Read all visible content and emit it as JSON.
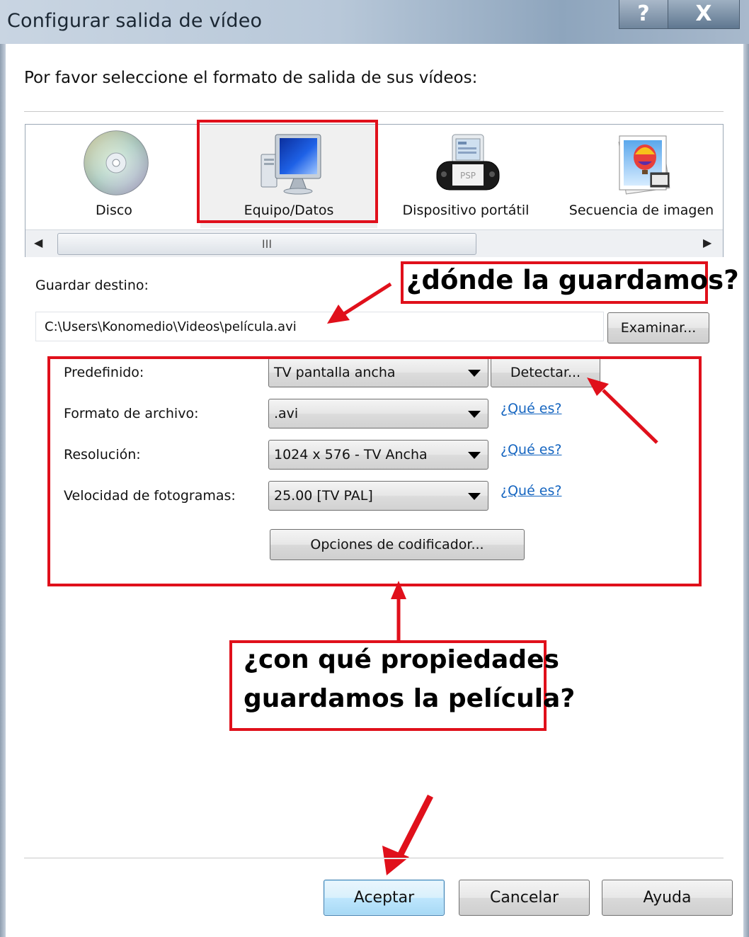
{
  "window": {
    "title": "Configurar salida de vídeo",
    "help_button": "?",
    "close_button": "X"
  },
  "prompt": "Por favor seleccione el formato de salida de sus vídeos:",
  "formats": [
    {
      "label": "Disco",
      "icon": "disc-icon"
    },
    {
      "label": "Equipo/Datos",
      "icon": "computer-icon"
    },
    {
      "label": "Dispositivo portátil",
      "icon": "psp-device-icon"
    },
    {
      "label": "Secuencia de imagen",
      "icon": "image-sequence-icon"
    }
  ],
  "psp_text": "PSP",
  "scrollbar": {
    "thumb_grip": "III",
    "left_arrow": "◀",
    "right_arrow": "▶"
  },
  "destination": {
    "label": "Guardar destino:",
    "value": "C:\\Users\\Konomedio\\Videos\\película.avi",
    "browse_button": "Examinar..."
  },
  "settings": {
    "preset_label": "Predefinido:",
    "preset_value": "TV pantalla ancha",
    "detect_button": "Detectar...",
    "file_format_label": "Formato de archivo:",
    "file_format_value": ".avi",
    "resolution_label": "Resolución:",
    "resolution_value": "1024 x 576 - TV Ancha",
    "framerate_label": "Velocidad de fotogramas:",
    "framerate_value": "25.00 [TV PAL]",
    "what_is_link": "¿Qué es?",
    "encoder_button": "Opciones de codificador..."
  },
  "annotations": {
    "where_save": "¿dónde la guardamos?",
    "properties_line1": "¿con qué propiedades",
    "properties_line2": "guardamos la película?",
    "highlight_color": "#e0101b"
  },
  "footer": {
    "accept_button": "Aceptar",
    "cancel_button": "Cancelar",
    "help_button": "Ayuda"
  }
}
